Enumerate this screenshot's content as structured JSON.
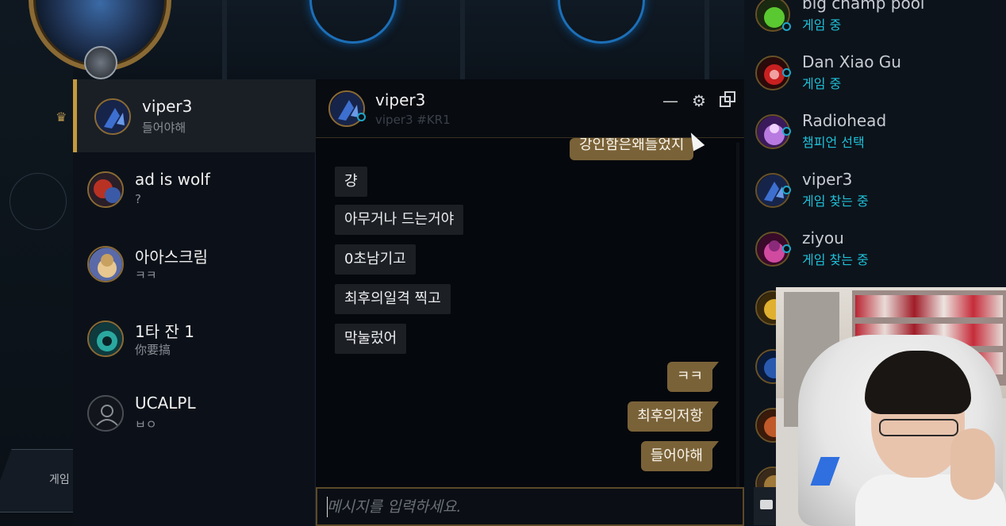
{
  "chat_list": [
    {
      "name": "viper3",
      "sub": "들어야해",
      "active": true,
      "avatar_color": "#2a4a8a"
    },
    {
      "name": "ad is wolf",
      "sub": "?",
      "active": false,
      "avatar_color": "#7a2a24"
    },
    {
      "name": "아아스크림",
      "sub": "ㅋㅋ",
      "active": false,
      "avatar_color": "#8a6a44"
    },
    {
      "name": "1타 잔 1",
      "sub": "你要搞",
      "active": false,
      "avatar_color": "#1f6a6a"
    },
    {
      "name": "UCALPL",
      "sub": "ㅂㅇ",
      "active": false,
      "avatar_color": "#1a1e24"
    }
  ],
  "chat": {
    "name": "viper3",
    "tag": "viper3 #KR1",
    "partial_message": "강인함은왜들었지",
    "messages_in": [
      "걍",
      "아무거나 드는거야",
      "0초남기고",
      "최후의일격 찍고",
      "막눌렀어"
    ],
    "messages_out": [
      "ㅋㅋ",
      "최후의저항",
      "들어야해"
    ],
    "input_placeholder": "메시지를 입력하세요."
  },
  "right_list": [
    {
      "name": "big champ pool",
      "status": "게임 중",
      "avatar_color": "#2a6a1a"
    },
    {
      "name": "Dan Xiao Gu",
      "status": "게임 중",
      "avatar_color": "#8a1a1a"
    },
    {
      "name": "Radiohead",
      "status": "챔피언 선택",
      "avatar_color": "#6a3a8a"
    },
    {
      "name": "viper3",
      "status": "게임 찾는 중",
      "avatar_color": "#2a4a8a"
    },
    {
      "name": "ziyou",
      "status": "게임 찾는 중",
      "avatar_color": "#8a2a6a"
    }
  ],
  "background": {
    "bottom_button_text": "게임"
  },
  "colors": {
    "accent_gold": "#c49a3c",
    "status_cyan": "#1fc0d8",
    "out_bubble": "#7a6238",
    "in_bubble": "#1c1f24"
  }
}
